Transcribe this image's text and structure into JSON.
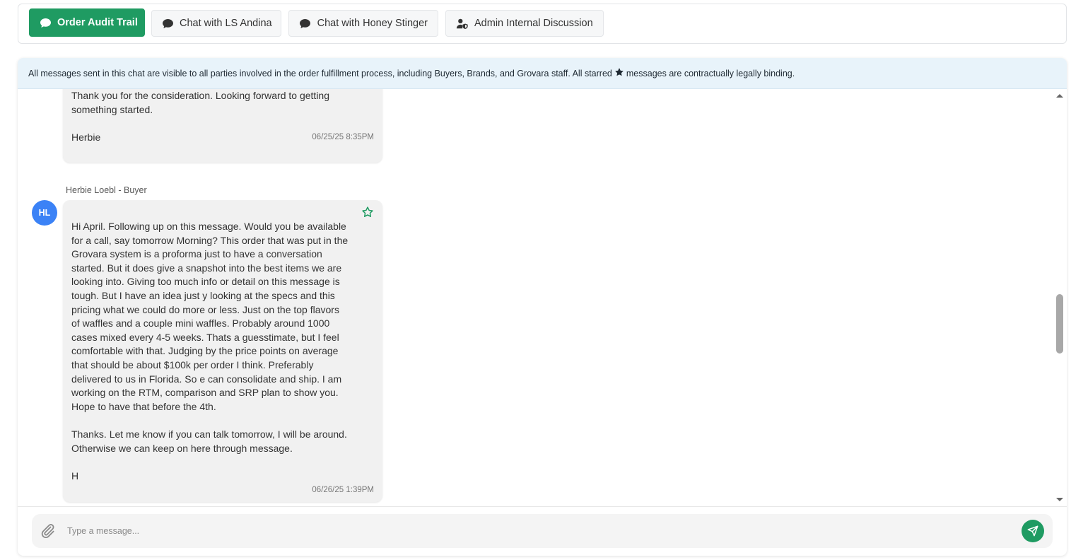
{
  "tabs": [
    {
      "label": "Order Audit Trail",
      "icon": "chat-bubble-icon",
      "active": true
    },
    {
      "label": "Chat with LS Andina",
      "icon": "chat-bubble-icon",
      "active": false
    },
    {
      "label": "Chat with Honey Stinger",
      "icon": "chat-bubble-icon",
      "active": false
    },
    {
      "label": "Admin Internal Discussion",
      "icon": "user-shield-icon",
      "active": false
    }
  ],
  "notice": {
    "before": "All messages sent in this chat are visible to all parties involved in the order fulfillment process, including Buyers, Brands, and Grovara staff. All starred",
    "after": "messages are contractually legally binding."
  },
  "messages": [
    {
      "text": "Thank you for the consideration. Looking forward to getting\nsomething started.\n\nHerbie",
      "timestamp": "06/25/25 8:35PM"
    },
    {
      "sender": "Herbie Loebl - Buyer",
      "initials": "HL",
      "starred": false,
      "text": "Hi April. Following up on this message. Would you be available\nfor a call, say tomorrow Morning? This order that was put in the\nGrovara system is a proforma just to have a conversation\nstarted. But it does give a snapshot into the best items we are\nlooking into. Giving too much info or detail on this message is\ntough. But I have an idea just y looking at the specs and this\npricing what we could do more or less. Just on the top flavors\nof waffles and a couple mini waffles. Probably around 1000\ncases mixed every 4-5 weeks. Thats a guesstimate, but I feel\ncomfortable with that. Judging by the price points on average\nthat should be about $100k per order I think. Preferably\ndelivered to us in Florida. So e can consolidate and ship. I am\nworking on the RTM, comparison and SRP plan to show you.\nHope to have that before the 4th.\n\nThanks. Let me know if you can talk tomorrow, I will be around.\nOtherwise we can keep on here through message.\n\nH",
      "timestamp": "06/26/25 1:39PM"
    }
  ],
  "composer": {
    "placeholder": "Type a message...",
    "value": ""
  },
  "colors": {
    "accent": "#1f9b62",
    "avatar": "#3b82f6",
    "notice_bg": "#e8f3fa"
  }
}
